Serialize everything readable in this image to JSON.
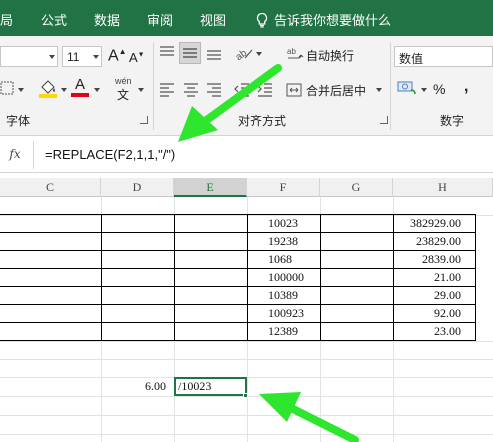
{
  "menu": {
    "items": [
      "局",
      "公式",
      "数据",
      "审阅",
      "视图"
    ],
    "tell_me": "告诉我你想要做什么"
  },
  "ribbon": {
    "font_size": "11",
    "font_group_label": "字体",
    "alignment_group_label": "对齐方式",
    "wrap_text": "自动换行",
    "merge_center": "合并后居中",
    "number_format": "数值",
    "number_group_label": "数字",
    "percent": "%",
    "comma": ",",
    "wen": "wén",
    "font_grow": "A",
    "font_shrink": "A",
    "font_color_letter": "A"
  },
  "formula_bar": {
    "fx": "fx",
    "formula": "=REPLACE(F2,1,1,\"/\")"
  },
  "columns": [
    "C",
    "D",
    "E",
    "F",
    "G",
    "H"
  ],
  "selected_column": "E",
  "table": {
    "F": [
      "10023",
      "19238",
      "1068",
      "100000",
      "10389",
      "100923",
      "12389"
    ],
    "H": [
      "382929.00",
      "23829.00",
      "2839.00",
      "21.00",
      "29.00",
      "92.00",
      "23.00"
    ]
  },
  "extra_cells": {
    "D": "6.00",
    "E": "/10023"
  },
  "colors": {
    "excel_green": "#217346",
    "arrow_green": "#2ee62e",
    "highlight_yellow": "#ffd800",
    "font_red": "#e0001b"
  }
}
